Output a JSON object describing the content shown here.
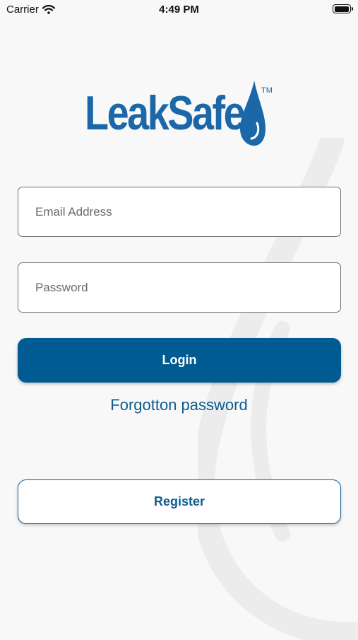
{
  "status_bar": {
    "carrier": "Carrier",
    "time": "4:49 PM",
    "battery_level": 1.0
  },
  "logo": {
    "text": "LeakSafe",
    "trademark": "TM",
    "icon": "water-drop-icon"
  },
  "form": {
    "email_placeholder": "Email Address",
    "email_value": "",
    "password_placeholder": "Password",
    "password_value": ""
  },
  "actions": {
    "login_label": "Login",
    "forgot_label": "Forgotton password",
    "register_label": "Register"
  },
  "colors": {
    "brand_blue": "#005b93",
    "link_blue": "#0d5c8f",
    "logo_blue": "#1b67a8",
    "background": "#f8f8f8"
  }
}
